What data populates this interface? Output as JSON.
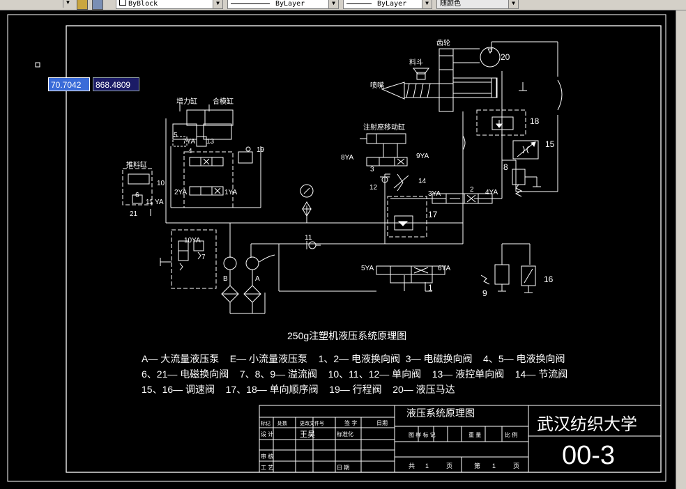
{
  "toolbar": {
    "layer_color": "ByBlock",
    "linetype": "ByLayer",
    "lineweight": "ByLayer",
    "plot_style": "随颜色"
  },
  "input": {
    "x_value": "70.7042",
    "y_value": "868.4809"
  },
  "drawing": {
    "title": "250g注塑机液压系统原理图",
    "legend": [
      "A— 大流量液压泵    E— 小流量液压泵    1、2— 电液换向阀  3— 电磁换向阀    4、5— 电液换向阀",
      "6、21— 电磁换向阀    7、8、9— 溢流阀    10、11、12— 单向阀    13— 液控单向阀    14— 节流阀",
      "15、16— 调速阀    17、18— 单向顺序阀    19— 行程阀    20— 液压马达"
    ],
    "labels": {
      "gear": "齿轮",
      "hopper": "料斗",
      "nozzle": "喷嘴",
      "booster_cyl": "增力缸",
      "mold_cyl": "合模缸",
      "push_cyl": "推料缸",
      "injector_cyl": "注射座移动缸",
      "n20": "20",
      "n18": "18",
      "n15": "15",
      "n8": "8",
      "n9": "9",
      "n16": "16",
      "n17": "17",
      "n1": "1",
      "n2": "2",
      "n3": "3",
      "n4": "4",
      "n5": "5",
      "n6": "6",
      "n10": "10",
      "n11": "11",
      "n12": "12",
      "n13": "13",
      "n14": "14",
      "n19": "19",
      "n21": "21",
      "n7": "7",
      "ya3": "3YA",
      "ya4": "4YA",
      "ya5": "5YA",
      "ya6": "6YA",
      "ya8": "8YA",
      "ya9": "9YA",
      "ya1": "1YA",
      "ya2": "2YA",
      "ya7": "7YA",
      "ya10": "10YA",
      "ya11": "11 YA",
      "pumpA": "A",
      "pumpB": "B"
    }
  },
  "title_block": {
    "name": "液压系统原理图",
    "school": "武汉纺织大学",
    "code": "00-3",
    "headers": [
      "标记",
      "处数",
      "更改文件号",
      "签 字",
      "日期"
    ],
    "designer_role": "设 计",
    "designer": "王昊",
    "standard": "标准化",
    "review": "审 核",
    "process": "工 艺",
    "date": "日 期",
    "stage": "图 样 标 记",
    "weight": "重 量",
    "scale": "比 例",
    "sheet_total": "共",
    "sheet_total_val": "1",
    "sheet_page": "页",
    "sheet_no": "第",
    "sheet_no_val": "1",
    "sheet_page2": "页"
  }
}
